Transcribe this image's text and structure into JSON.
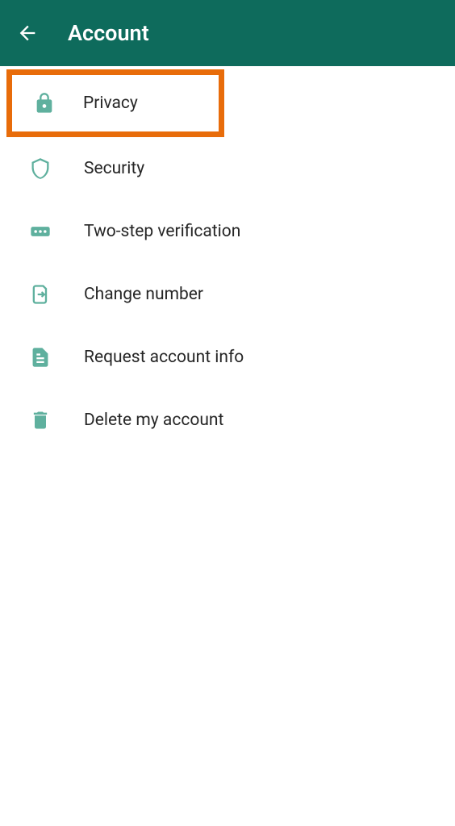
{
  "header": {
    "title": "Account"
  },
  "menu": {
    "items": [
      {
        "label": "Privacy",
        "icon": "lock",
        "highlighted": true
      },
      {
        "label": "Security",
        "icon": "shield",
        "highlighted": false
      },
      {
        "label": "Two-step verification",
        "icon": "dots",
        "highlighted": false
      },
      {
        "label": "Change number",
        "icon": "sim-swap",
        "highlighted": false
      },
      {
        "label": "Request account info",
        "icon": "document",
        "highlighted": false
      },
      {
        "label": "Delete my account",
        "icon": "trash",
        "highlighted": false
      }
    ]
  },
  "colors": {
    "headerBg": "#0e6b5c",
    "iconColor": "#5fb09e",
    "highlightBorder": "#e86c0a"
  }
}
